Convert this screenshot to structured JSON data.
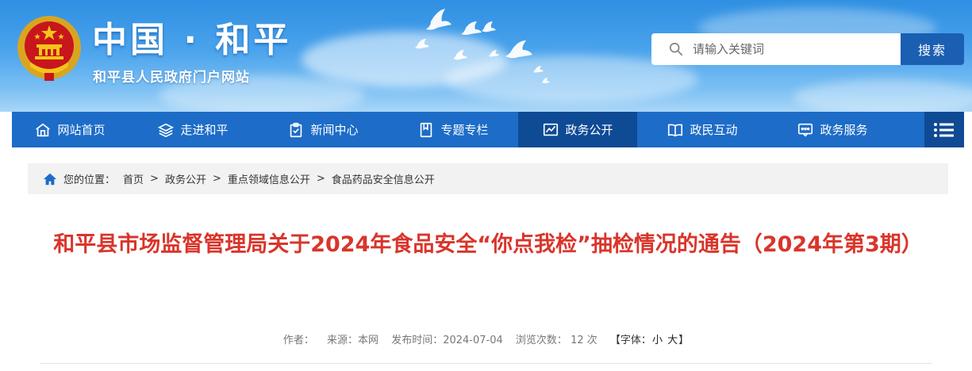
{
  "header": {
    "site_title": "中国 · 和平",
    "site_subtitle": "和平县人民政府门户网站"
  },
  "search": {
    "placeholder": "请输入关键词",
    "button_label": "搜索"
  },
  "nav": {
    "items": [
      {
        "label": "网站首页",
        "icon": "home-icon"
      },
      {
        "label": "走进和平",
        "icon": "layers-icon"
      },
      {
        "label": "新闻中心",
        "icon": "clipboard-icon"
      },
      {
        "label": "专题专栏",
        "icon": "bookmark-icon"
      },
      {
        "label": "政务公开",
        "icon": "chart-icon",
        "active": true
      },
      {
        "label": "政民互动",
        "icon": "book-icon"
      },
      {
        "label": "政务服务",
        "icon": "service-icon"
      }
    ],
    "menu_icon": "menu-icon"
  },
  "breadcrumb": {
    "prefix": "您的位置：",
    "items": [
      "首页",
      "政务公开",
      "重点领域信息公开",
      "食品药品安全信息公开"
    ],
    "separator": ">"
  },
  "article": {
    "title": "和平县市场监督管理局关于2024年食品安全“你点我检”抽检情况的通告（2024年第3期）",
    "author_label": "作者：",
    "author": "",
    "source_label": "来源：",
    "source": "本网",
    "date_label": "发布时间：",
    "date": "2024-07-04",
    "views_label": "浏览次数：",
    "views": "12",
    "views_unit": "次",
    "font_label": "【字体：",
    "font_small": "小",
    "font_large": "大",
    "font_close": "】"
  },
  "colors": {
    "nav_bg": "#1d6cc7",
    "nav_active": "#0f4a95",
    "title_red": "#d9352b",
    "search_button": "#1b5fb3"
  }
}
